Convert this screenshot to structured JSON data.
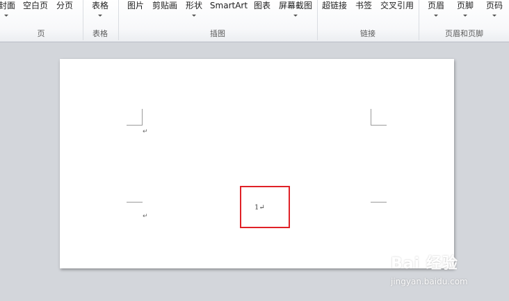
{
  "ribbon": {
    "buttons": [
      {
        "label": "封面",
        "has_dropdown": true
      },
      {
        "label": "空白页",
        "has_dropdown": false
      },
      {
        "label": "分页",
        "has_dropdown": false
      },
      {
        "label": "表格",
        "has_dropdown": true
      },
      {
        "label": "图片",
        "has_dropdown": false
      },
      {
        "label": "剪贴画",
        "has_dropdown": false
      },
      {
        "label": "形状",
        "has_dropdown": true
      },
      {
        "label": "SmartArt",
        "has_dropdown": false
      },
      {
        "label": "图表",
        "has_dropdown": false
      },
      {
        "label": "屏幕截图",
        "has_dropdown": true
      },
      {
        "label": "超链接",
        "has_dropdown": false
      },
      {
        "label": "书签",
        "has_dropdown": false
      },
      {
        "label": "交叉引用",
        "has_dropdown": false
      },
      {
        "label": "页眉",
        "has_dropdown": true
      },
      {
        "label": "页脚",
        "has_dropdown": true
      },
      {
        "label": "页码",
        "has_dropdown": true
      }
    ],
    "groups": [
      {
        "label": "页"
      },
      {
        "label": "表格"
      },
      {
        "label": "插图"
      },
      {
        "label": "链接"
      },
      {
        "label": "页眉和页脚"
      }
    ]
  },
  "document": {
    "paragraph_mark": "↵",
    "page_number_text": "1↵"
  },
  "watermark": {
    "logo_text": "Bai 经验",
    "site_text": "jingyan.baidu.com"
  },
  "colors": {
    "highlight_border": "#e02127",
    "ribbon_bg": "#f7f8fa",
    "workspace_bg": "#d3d6db"
  }
}
